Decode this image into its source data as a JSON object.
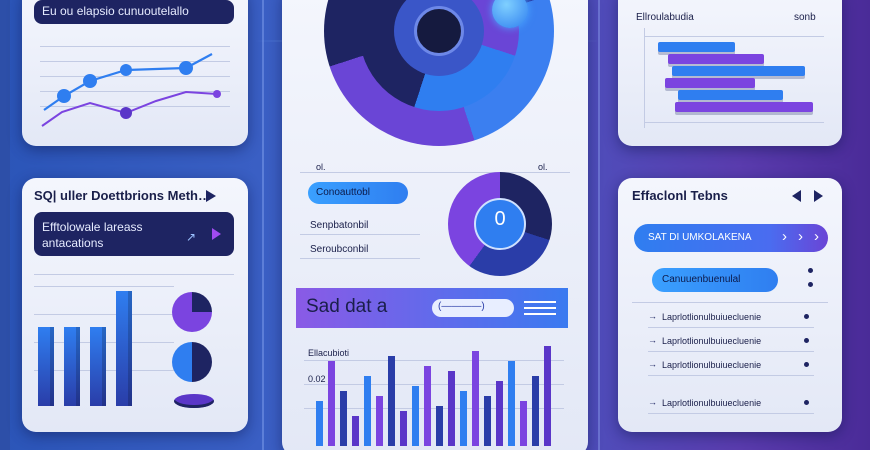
{
  "top_left_card": {
    "header_text": "Eu ou elapsio cunuoutelallo"
  },
  "methods_card": {
    "title": "SQ| uller Doettbrions Methars",
    "play_icon": "play-icon",
    "banner": {
      "line1": "Efftolowale lareass",
      "line2": "antacations"
    },
    "bars": [
      0.62,
      0.62,
      0.62,
      0.9
    ]
  },
  "center_card": {
    "label_left": "ol.",
    "label_right": "ol.",
    "pill_label": "Conoauttobl",
    "rows": [
      "Senpbatonbil",
      "Seroubconbil"
    ],
    "donut_value": "0",
    "highlight": {
      "title": "Sad dat a",
      "chip": "(————)"
    },
    "sub_labels": [
      "Ellacubioti",
      "0.02"
    ],
    "bars": [
      0.45,
      0.85,
      0.55,
      0.3,
      0.7,
      0.5,
      0.9,
      0.35,
      0.6,
      0.8,
      0.4,
      0.75,
      0.55,
      0.95,
      0.5,
      0.65,
      0.85,
      0.45,
      0.7,
      1.0
    ]
  },
  "gantt_card": {
    "header": "Ellroulabudia",
    "header_right": "sonb",
    "bars": [
      0.45,
      0.6,
      0.85,
      0.55,
      0.7,
      0.9
    ]
  },
  "efficient_tabs_card": {
    "title": "Effaclonl Tebns",
    "pill_label": "SAT DI UMKOLAKENA",
    "sub_pill": "Canuuenbuenulal",
    "rows": [
      "Laprlotlionulbuiuecluenie",
      "Laprlotlionulbuiuecluenie",
      "Laprlotlionulbuiuecluenie",
      "Laprlotlionulbuiuecluenie"
    ]
  },
  "colors": {
    "accent_blue": "#2f7ef0",
    "accent_purple": "#7b44e0",
    "navy": "#1e2462",
    "panel": "#eef1fa"
  }
}
